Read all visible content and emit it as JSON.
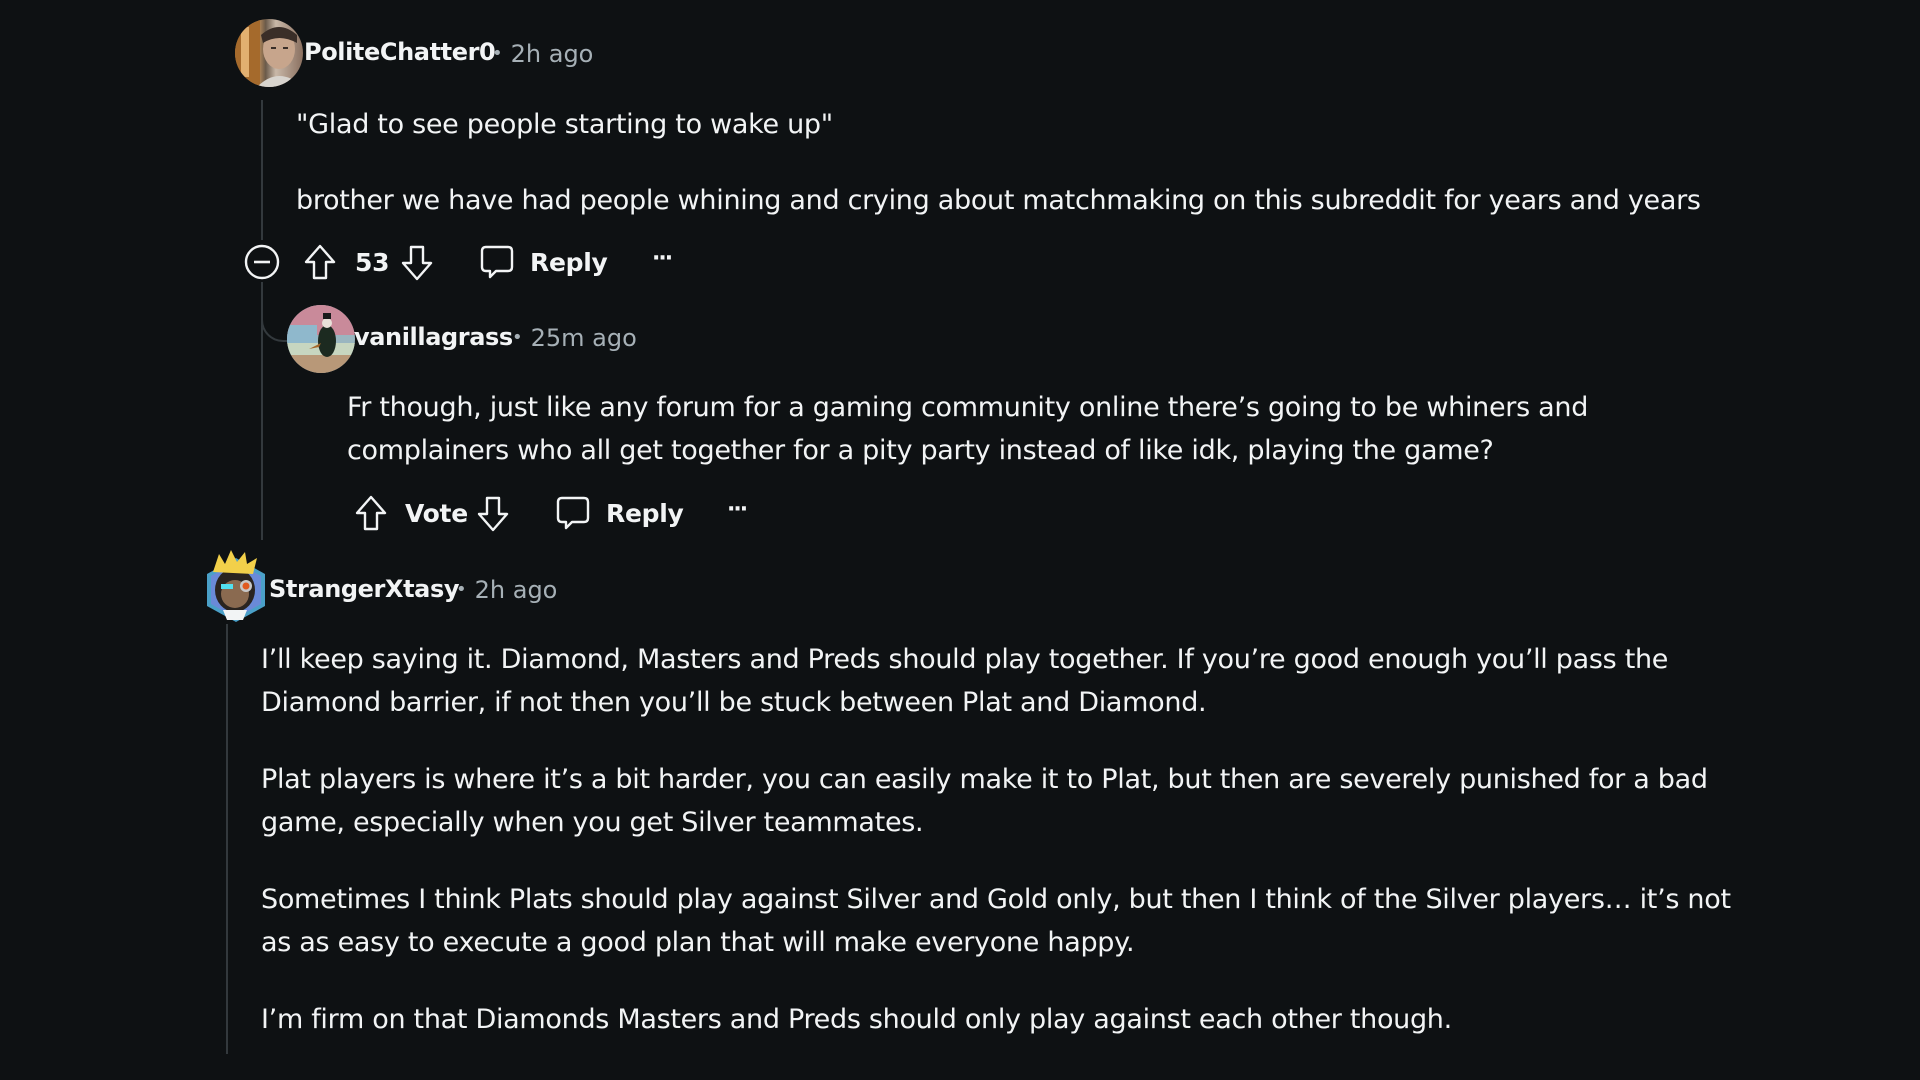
{
  "comments": [
    {
      "username": "PoliteChatter0",
      "time": "2h ago",
      "separator": "•",
      "paragraphs": [
        "\"Glad to see people starting to wake up\"",
        "brother we have had people whining and crying about matchmaking on this subreddit for years and years"
      ],
      "score": "53",
      "reply_label": "Reply",
      "more_label": "···",
      "collapsed": false,
      "replies": [
        {
          "username": "vanillagrass",
          "time": "25m ago",
          "separator": "•",
          "paragraphs": [
            "Fr though, just like any forum for a gaming community online there’s going to be whiners and complainers who all get together for a pity party instead of like idk, playing the game?"
          ],
          "score": "Vote",
          "reply_label": "Reply",
          "more_label": "···"
        }
      ]
    },
    {
      "username": "StrangerXtasy",
      "time": "2h ago",
      "separator": "•",
      "paragraphs": [
        "I’ll keep saying it. Diamond, Masters and Preds should play together. If you’re good enough you’ll pass the Diamond barrier, if not then you’ll be stuck between Plat and Diamond.",
        "Plat players is where it’s a bit harder, you can easily make it to Plat, but then are severely punished for a bad game, especially when you get Silver teammates.",
        "Sometimes I think Plats should play against Silver and Gold only, but then I think of the Silver players… it’s not as as easy to execute a good plan that will make everyone happy.",
        "I’m firm on that Diamonds Masters and Preds should only play against each other though."
      ]
    }
  ],
  "colors": {
    "background": "#0e1113",
    "text": "#f2f4f5",
    "meta": "#a6b0b6",
    "thread_line": "#33393d"
  }
}
